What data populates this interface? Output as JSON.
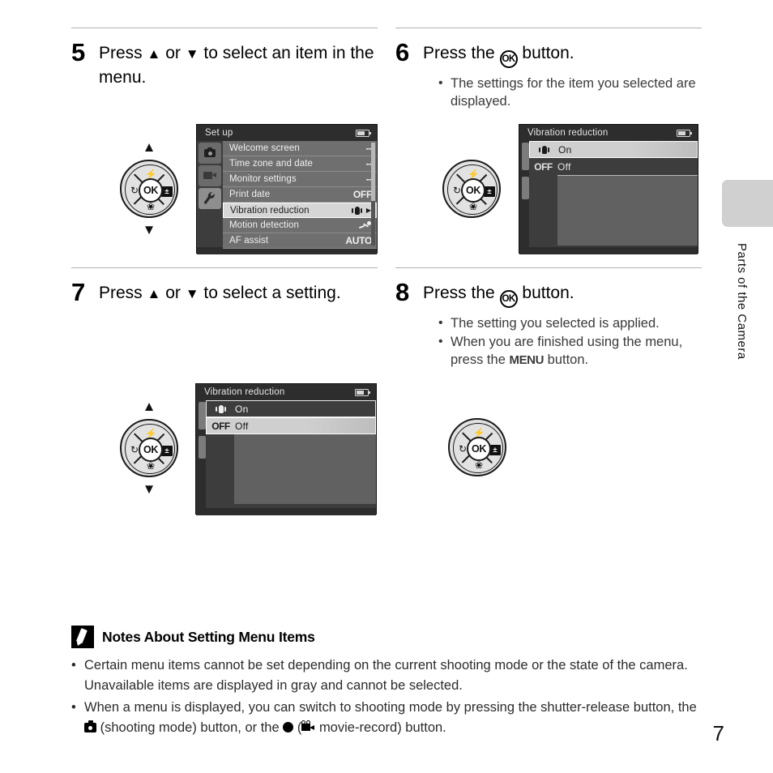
{
  "document": {
    "page_number": "7",
    "side_tab_label": "Parts of the Camera"
  },
  "steps": [
    {
      "number": "5",
      "text_before": "Press",
      "text_middle": "or",
      "text_after": "to select an item in the menu.",
      "bullets": []
    },
    {
      "number": "6",
      "text_before": "Press the",
      "text_after": "button.",
      "bullets": [
        "The settings for the item you selected are displayed."
      ]
    },
    {
      "number": "7",
      "text_before": "Press",
      "text_middle": "or",
      "text_after": "to select a setting.",
      "bullets": []
    },
    {
      "number": "8",
      "text_before": "Press the",
      "text_after": "button.",
      "bullets": [
        "The setting you selected is applied."
      ],
      "bullet2_part1": "When you are finished using the menu, press the",
      "bullet2_menu": "MENU",
      "bullet2_part2": "button."
    }
  ],
  "setup_screen": {
    "title": "Set up",
    "battery_icon": "battery-icon",
    "tabs": [
      {
        "icon": "camera-icon",
        "selected": false
      },
      {
        "icon": "movie-camera-icon",
        "selected": false
      },
      {
        "icon": "wrench-icon",
        "selected": true,
        "glyph": "Ɣ"
      }
    ],
    "rows": [
      {
        "label": "Welcome screen",
        "value": "--",
        "type": "dash",
        "highlighted": false
      },
      {
        "label": "Time zone and date",
        "value": "--",
        "type": "dash",
        "highlighted": false
      },
      {
        "label": "Monitor settings",
        "value": "--",
        "type": "dash",
        "highlighted": false
      },
      {
        "label": "Print date",
        "value": "OFF",
        "type": "text",
        "highlighted": false
      },
      {
        "label": "Vibration reduction",
        "value": "",
        "type": "vr",
        "highlighted": true,
        "arrow": "▶"
      },
      {
        "label": "Motion detection",
        "value": "",
        "type": "md",
        "highlighted": false
      },
      {
        "label": "AF assist",
        "value": "AUTO",
        "type": "text",
        "highlighted": false
      }
    ]
  },
  "vr_screen_step6": {
    "title": "Vibration reduction",
    "battery_icon": "battery-icon",
    "rows": [
      {
        "icon_label": "",
        "label": "On",
        "icon_type": "vr",
        "highlighted": true
      },
      {
        "icon_label": "OFF",
        "label": "Off",
        "icon_type": "text",
        "highlighted": false
      }
    ]
  },
  "vr_screen_step7": {
    "title": "Vibration reduction",
    "battery_icon": "battery-icon",
    "rows": [
      {
        "icon_label": "",
        "label": "On",
        "icon_type": "vr",
        "highlighted": false
      },
      {
        "icon_label": "OFF",
        "label": "Off",
        "icon_type": "text",
        "highlighted": true
      }
    ]
  },
  "multi_selector": {
    "center_label": "OK",
    "top_icon": "flash-icon",
    "top_glyph": "⚡",
    "left_icon": "self-timer-icon",
    "left_glyph": "⏱",
    "right_icon": "exposure-compensation-icon",
    "right_glyph": "±",
    "bottom_icon": "macro-icon",
    "bottom_glyph": "❀",
    "up_arrow": "▲",
    "down_arrow": "▼"
  },
  "notes": {
    "icon": "pencil-icon",
    "title": "Notes About Setting Menu Items",
    "items": [
      "Certain menu items cannot be set depending on the current shooting mode or the state of the camera. Unavailable items are displayed in gray and cannot be selected."
    ],
    "item2_part1": "When a menu is displayed, you can switch to shooting mode by pressing the shutter-release button, the",
    "item2_part2": "(shooting mode) button, or the",
    "item2_part3": "(",
    "item2_part4": "movie-record) button."
  }
}
